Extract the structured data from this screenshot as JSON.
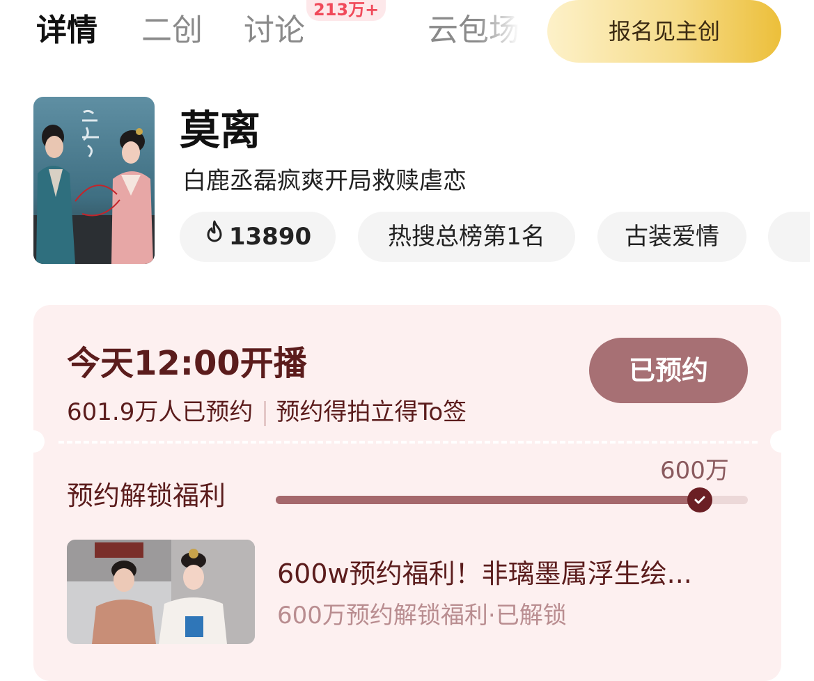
{
  "tabs": {
    "details": "详情",
    "create": "二创",
    "discuss": "讨论",
    "discuss_badge": "213万+",
    "cloud": "云包场"
  },
  "signup_button": "报名见主创",
  "show": {
    "title": "莫离",
    "subtitle": "白鹿丞磊疯爽开局救赎虐恋",
    "heat": "13890",
    "rank_tag": "热搜总榜第1名",
    "genre_tag": "古装爱情"
  },
  "reservation": {
    "air_time": "今天12:00开播",
    "reserved_count": "601.9万人已预约",
    "reward_note": "预约得拍立得To签",
    "button": "已预约",
    "unlock_label": "预约解锁福利",
    "milestone": "600万",
    "progress": 0.9,
    "perk_title": "600w预约福利！非璃墨属浮生绘...",
    "perk_subtitle": "600万预约解锁福利·已解锁"
  },
  "colors": {
    "accent_dark": "#5b1c1c",
    "button_mauve": "#a77074",
    "card_bg": "#fdf0f0",
    "badge_red": "#f04a5a",
    "gold": "#ecbf3a"
  },
  "icons": [
    "flame-icon",
    "check-icon"
  ]
}
